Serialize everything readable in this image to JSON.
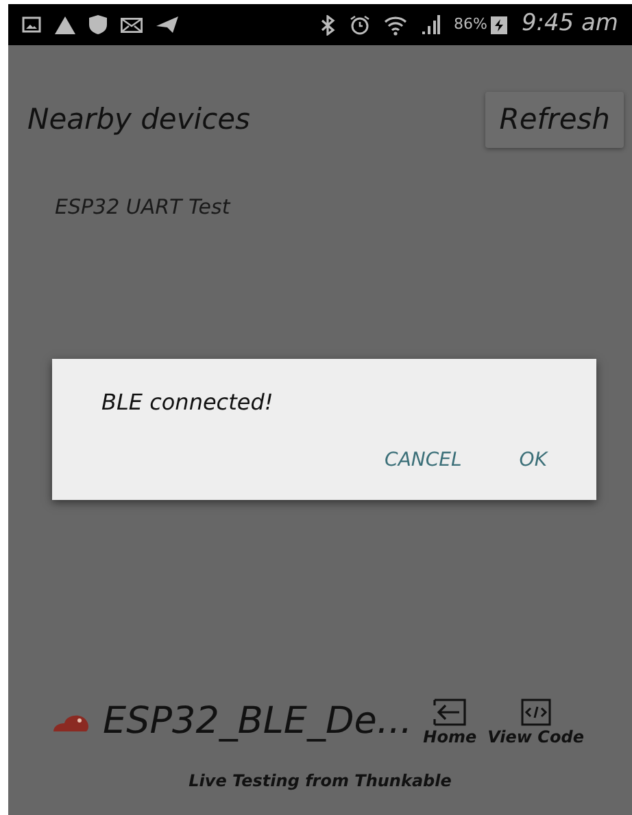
{
  "status_bar": {
    "battery": "86%",
    "time": "9:45 am"
  },
  "header": {
    "title": "Nearby devices",
    "refresh_button": "Refresh"
  },
  "devices": [
    {
      "name": "ESP32 UART Test"
    }
  ],
  "dialog": {
    "message": "BLE connected!",
    "buttons": [
      "CANCEL",
      "OK"
    ]
  },
  "app_bar": {
    "project_name": "ESP32_BLE_De...",
    "actions": [
      {
        "kind": "home",
        "label": "Home"
      },
      {
        "kind": "code",
        "label": "View Code"
      }
    ]
  },
  "footer": "Live Testing from Thunkable"
}
